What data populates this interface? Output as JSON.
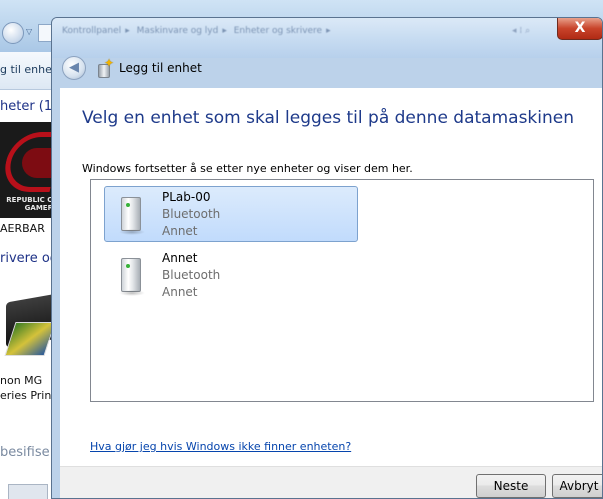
{
  "background_window": {
    "toolbar_text": "g til enhet",
    "section_heading": "heter (1)",
    "device1_brand_lines": [
      "REPUBLIC OF",
      "GAMERS"
    ],
    "device1_name": "AERBAR",
    "section_heading2": "rivere og",
    "device2_name_line1": "non MG",
    "device2_name_line2": "eries Prin",
    "section_heading3": "besifise"
  },
  "dialog": {
    "breadcrumb": [
      "Kontrollpanel",
      "Maskinvare og lyd",
      "Enheter og skrivere"
    ],
    "close_label": "X",
    "title": "Legg til enhet",
    "main_heading": "Velg en enhet som skal legges til på denne datamaskinen",
    "subtext": "Windows fortsetter å se etter nye enheter og viser dem her.",
    "devices": [
      {
        "name": "PLab-00",
        "type": "Bluetooth",
        "category": "Annet",
        "selected": true
      },
      {
        "name": "Annet",
        "type": "Bluetooth",
        "category": "Annet",
        "selected": false
      }
    ],
    "help_link": "Hva gjør jeg hvis Windows ikke finner enheten?",
    "buttons": {
      "next": "Neste",
      "cancel": "Avbryt"
    }
  },
  "colors": {
    "heading_blue": "#1e3a8a",
    "link_blue": "#0645ad",
    "selection_border": "#7da2ce",
    "close_red": "#c8432a"
  },
  "icons": {
    "back": "back-arrow-icon",
    "add_device": "add-device-icon",
    "device": "generic-device-icon",
    "close": "close-icon"
  }
}
